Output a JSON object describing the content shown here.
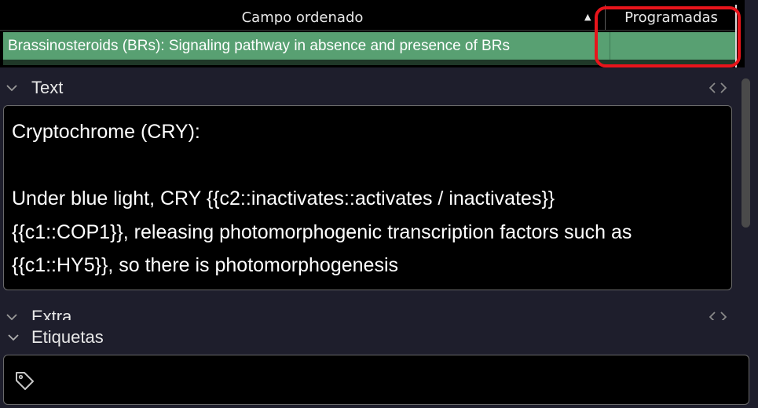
{
  "browse_table": {
    "columns": [
      {
        "label": "Campo ordenado",
        "sorted": true
      },
      {
        "label": "Programadas"
      }
    ],
    "rows": [
      {
        "sort_field": "Brassinosteroids (BRs):  Signaling pathway in absence and presence of BRs",
        "scheduled": ""
      }
    ],
    "selected_row_color": "#58a072",
    "highlight_color": "#e8141b"
  },
  "editor": {
    "fields": [
      {
        "name": "Text",
        "lines": [
          "Cryptochrome (CRY):",
          "",
          "Under blue light, CRY {{c2::inactivates::activates / inactivates}}",
          "{{c1::COP1}}, releasing photomorphogenic transcription factors such as",
          "{{c1::HY5}}, so there is photomorphogenesis"
        ]
      },
      {
        "name": "Extra",
        "lines": []
      }
    ],
    "tags": {
      "label": "Etiquetas",
      "value": ""
    }
  },
  "icons": {
    "collapse": "chevron-down-icon",
    "html_toggle": "code-brackets-icon",
    "tag": "tag-icon",
    "sort": "sort-up-arrow-icon"
  }
}
